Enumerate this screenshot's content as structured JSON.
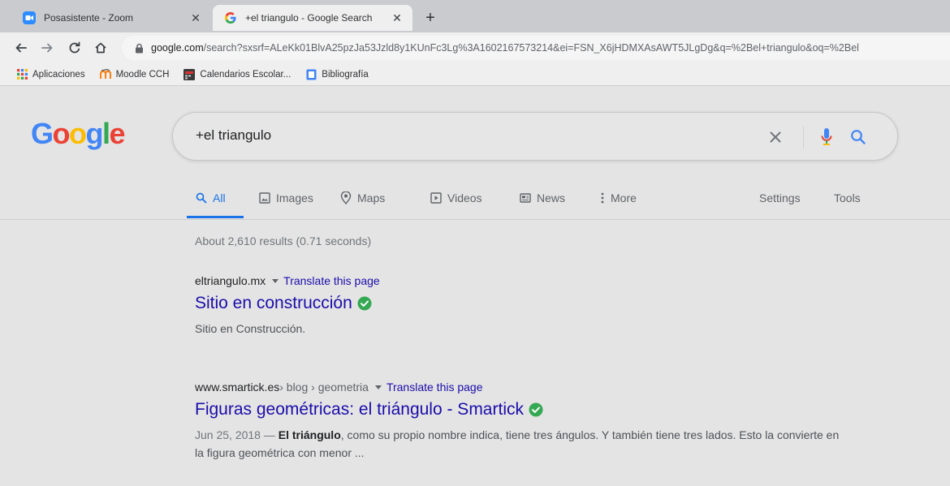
{
  "browser": {
    "tabs": [
      {
        "title": "Posasistente - Zoom",
        "favicon": "zoom-icon",
        "active": false
      },
      {
        "title": "+el triangulo - Google Search",
        "favicon": "google-g-icon",
        "active": true
      }
    ],
    "new_tab_label": "+",
    "close_glyph": "✕",
    "url_domain": "google.com",
    "url_rest": "/search?sxsrf=ALeKk01BlvA25pzJa53Jzld8y1KUnFc3Lg%3A1602167573214&ei=FSN_X6jHDMXAsAWT5JLgDg&q=%2Bel+triangulo&oq=%2Bel",
    "bookmarks": [
      {
        "label": "Aplicaciones",
        "icon": "apps-grid-icon"
      },
      {
        "label": "Moodle CCH",
        "icon": "moodle-icon"
      },
      {
        "label": "Calendarios Escolar...",
        "icon": "calendar-icon"
      },
      {
        "label": "Bibliografía",
        "icon": "document-icon"
      }
    ]
  },
  "google": {
    "logo_letters": [
      "G",
      "o",
      "o",
      "g",
      "l",
      "e"
    ],
    "logo_colors": [
      "#4285f4",
      "#ea4335",
      "#fbbc05",
      "#4285f4",
      "#34a853",
      "#ea4335"
    ],
    "query": "+el triangulo",
    "nav": {
      "all": "All",
      "images": "Images",
      "maps": "Maps",
      "videos": "Videos",
      "news": "News",
      "more": "More",
      "settings": "Settings",
      "tools": "Tools"
    },
    "stats": "About 2,610 results (0.71 seconds)",
    "results": [
      {
        "url": "eltriangulo.mx",
        "breadcrumbs": "",
        "translate": "Translate this page",
        "title": "Sitio en construcción",
        "verified": true,
        "date": "",
        "snippet_bold": "",
        "snippet": "Sitio en Construcción."
      },
      {
        "url": "www.smartick.es",
        "breadcrumbs": " › blog › geometria",
        "translate": "Translate this page",
        "title": "Figuras geométricas: el triángulo - Smartick",
        "verified": true,
        "date": "Jun 25, 2018 — ",
        "snippet_bold": "El triángulo",
        "snippet": ", como su propio nombre indica, tiene tres ángulos. Y también tiene tres lados. Esto la convierte en la figura geométrica con menor ..."
      }
    ]
  },
  "colors": {
    "accent": "#1a73e8",
    "link": "#1a0dab",
    "verified": "#34a853"
  }
}
